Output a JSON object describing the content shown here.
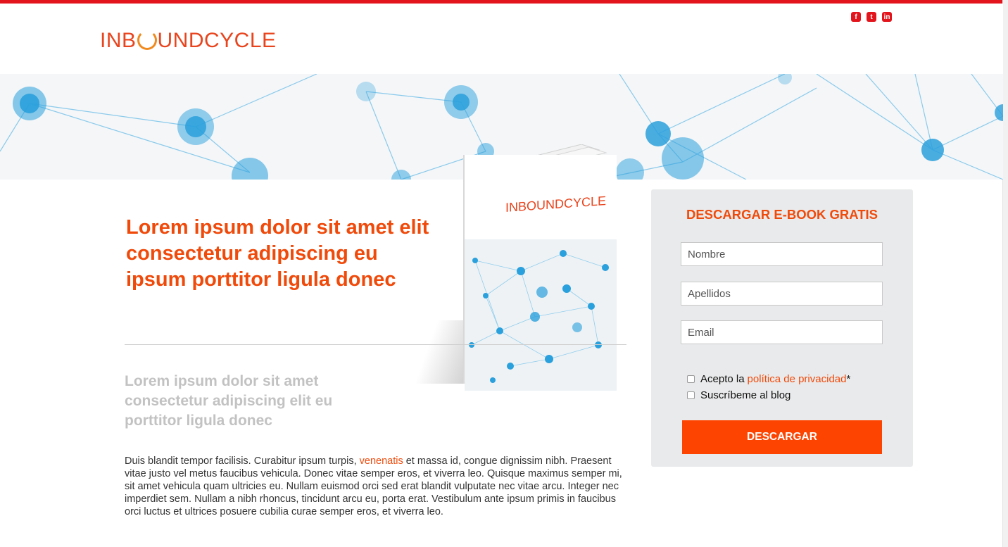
{
  "header": {
    "logo_prefix": "INB",
    "logo_suffix": "UNDCYCLE",
    "social": [
      {
        "icon": "facebook-icon",
        "glyph": "f"
      },
      {
        "icon": "twitter-icon",
        "glyph": "t"
      },
      {
        "icon": "linkedin-icon",
        "glyph": "in"
      }
    ]
  },
  "book": {
    "cover_logo": "INBOUNDCYCLE"
  },
  "main": {
    "headline": "Lorem ipsum dolor sit amet elit consectetur adipiscing eu ipsum porttitor ligula donec",
    "subheadline": "Lorem ipsum dolor sit amet consectetur adipiscing elit eu porttitor ligula donec",
    "body_before_link": "Duis blandit tempor facilisis. Curabitur ipsum turpis, ",
    "body_link": "venenatis",
    "body_after_link": " et massa id, congue dignissim nibh. Praesent vitae justo vel metus faucibus vehicula. Donec vitae semper eros, et viverra leo. Quisque maximus semper mi, sit amet vehicula quam ultricies eu. Nullam euismod orci sed erat blandit vulputate nec vitae arcu. Integer nec imperdiet sem. Nullam a nibh rhoncus, tincidunt arcu eu, porta erat. Vestibulum ante ipsum primis in faucibus orci luctus et ultrices posuere cubilia curae semper eros, et viverra leo."
  },
  "form": {
    "title": "DESCARGAR E-BOOK GRATIS",
    "fields": {
      "nombre_placeholder": "Nombre",
      "apellidos_placeholder": "Apellidos",
      "email_placeholder": "Email"
    },
    "privacy_prefix": "Acepto la",
    "privacy_link": "política de privacidad",
    "privacy_required": "*",
    "subscribe_label": "Suscríbeme al blog",
    "submit_label": "DESCARGAR"
  },
  "colors": {
    "accent": "#f04a0b",
    "top_bar": "#e3141b",
    "button": "#fe4401",
    "network_blue": "#2aa0dc"
  }
}
